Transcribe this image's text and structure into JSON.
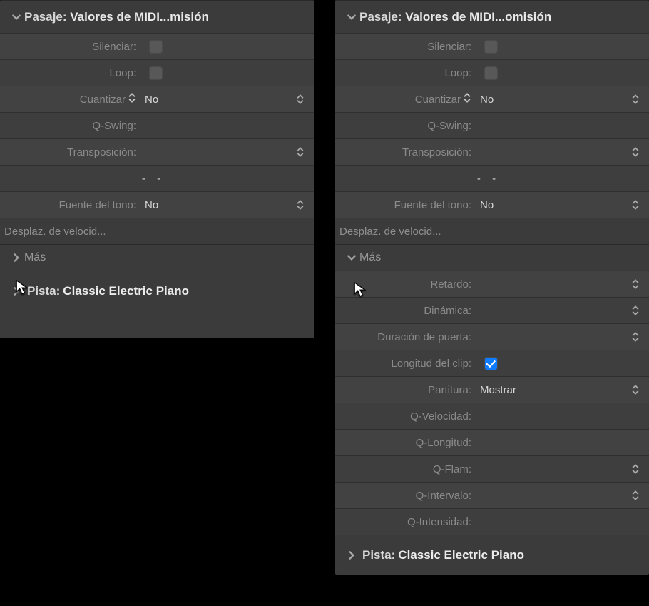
{
  "left": {
    "header": {
      "label": "Pasaje: ",
      "value": "Valores de MIDI...misión"
    },
    "rows": {
      "silenciar": "Silenciar:",
      "loop": "Loop:",
      "cuantizar": {
        "label": "Cuantizar",
        "value": "No"
      },
      "qswing": "Q-Swing:",
      "transposicion": "Transposición:",
      "ticks": "-   -",
      "fuente": {
        "label": "Fuente del tono:",
        "value": "No"
      },
      "desplaz": "Desplaz. de velocid..."
    },
    "mas": "Más",
    "pista": {
      "label": "Pista: ",
      "value": "Classic Electric Piano"
    }
  },
  "right": {
    "header": {
      "label": "Pasaje: ",
      "value": "Valores de MIDI...omisión"
    },
    "rows": {
      "silenciar": "Silenciar:",
      "loop": "Loop:",
      "cuantizar": {
        "label": "Cuantizar",
        "value": "No"
      },
      "qswing": "Q-Swing:",
      "transposicion": "Transposición:",
      "ticks": "-   -",
      "fuente": {
        "label": "Fuente del tono:",
        "value": "No"
      },
      "desplaz": "Desplaz. de velocid..."
    },
    "mas": "Más",
    "masItems": {
      "retardo": "Retardo:",
      "dinamica": "Dinámica:",
      "duracion": "Duración de puerta:",
      "longitud_clip": "Longitud del clip:",
      "partitura": {
        "label": "Partitura:",
        "value": "Mostrar"
      },
      "qvel": "Q-Velocidad:",
      "qlong": "Q-Longitud:",
      "qflam": "Q-Flam:",
      "qint": "Q-Intervalo:",
      "qintens": "Q-Intensidad:"
    },
    "pista": {
      "label": "Pista: ",
      "value": "Classic Electric Piano"
    }
  }
}
